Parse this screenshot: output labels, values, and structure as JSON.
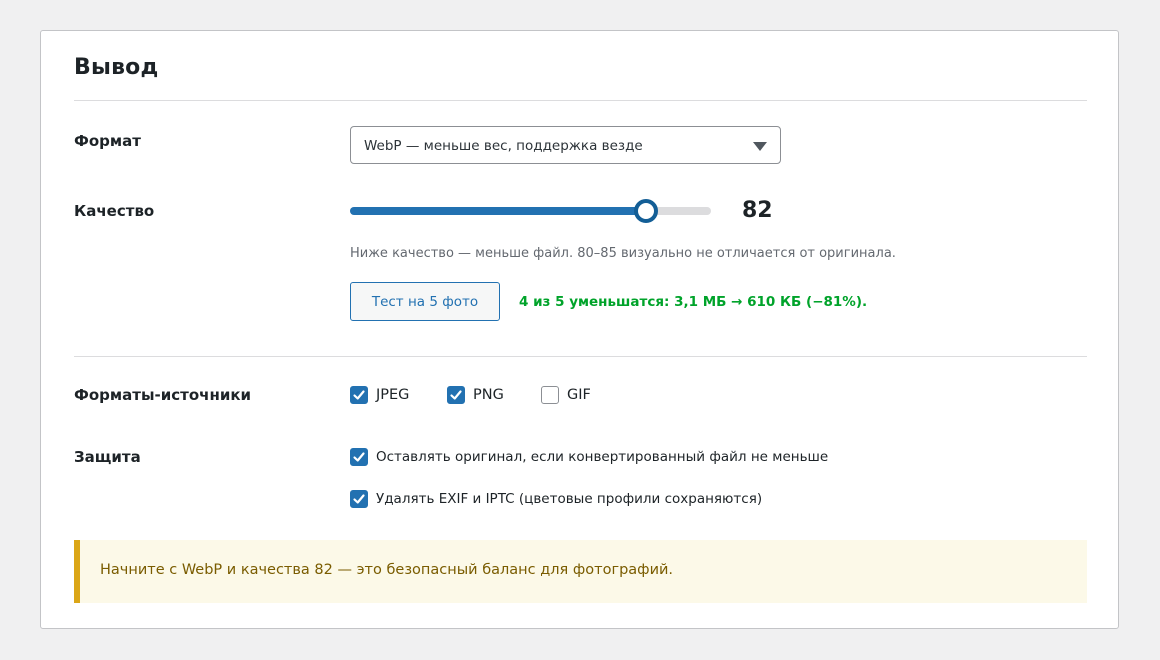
{
  "section": {
    "title": "Вывод"
  },
  "format": {
    "label": "Формат",
    "selected": "WebP — меньше вес, поддержка везде"
  },
  "quality": {
    "label": "Качество",
    "value": "82",
    "slider_fraction": 0.82,
    "hint": "Ниже качество — меньше файл. 80–85 визуально не отличается от оригинала.",
    "test_button": "Тест на 5 фото",
    "test_result": "4 из 5 уменьшатся: 3,1 МБ → 610 КБ (−81%)."
  },
  "sources": {
    "label": "Форматы-источники",
    "items": [
      {
        "label": "JPEG",
        "checked": true
      },
      {
        "label": "PNG",
        "checked": true
      },
      {
        "label": "GIF",
        "checked": false
      }
    ]
  },
  "protection": {
    "label": "Защита",
    "items": [
      {
        "label": "Оставлять оригинал, если конвертированный файл не меньше",
        "checked": true
      },
      {
        "label": "Удалять EXIF и IPTC (цветовые профили сохраняются)",
        "checked": true
      }
    ]
  },
  "notice": {
    "text": "Начните с WebP и качества 82 — это безопасный баланс для фотографий."
  },
  "colors": {
    "accent": "#2271b1",
    "success": "#00a32a",
    "notice_border": "#dba617",
    "notice_bg": "#fcf9e8"
  }
}
